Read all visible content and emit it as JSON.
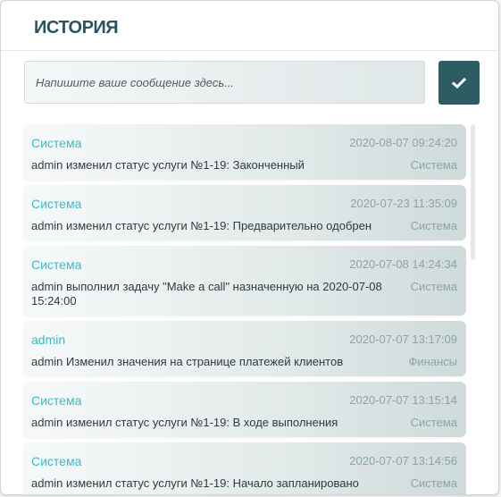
{
  "header": {
    "title": "ИСТОРИЯ"
  },
  "composer": {
    "placeholder": "Напишите ваше сообщение здесь...",
    "send_icon": "checkmark-icon",
    "accent_color": "#2e5c63"
  },
  "history": [
    {
      "author": "Система",
      "date": "2020-08-07 09:24:20",
      "text": "admin изменил статус услуги №1-19: Законченный",
      "category": "Система"
    },
    {
      "author": "Система",
      "date": "2020-07-23 11:35:09",
      "text": "admin изменил статус услуги №1-19: Предварительно одобрен",
      "category": "Система"
    },
    {
      "author": "Система",
      "date": "2020-07-08 14:24:34",
      "text": "admin выполнил задачу \"Make a call\" назначенную на 2020-07-08 15:24:00",
      "category": "Система"
    },
    {
      "author": "admin",
      "date": "2020-07-07 13:17:09",
      "text": "admin Изменил значения на странице платежей клиентов",
      "category": "Финансы"
    },
    {
      "author": "Система",
      "date": "2020-07-07 13:15:14",
      "text": "admin изменил статус услуги №1-19: В ходе выполнения",
      "category": "Система"
    },
    {
      "author": "Система",
      "date": "2020-07-07 13:14:56",
      "text": "admin изменил статус услуги №1-19: Начало запланировано",
      "category": "Система"
    }
  ],
  "colors": {
    "author": "#3fb8bf",
    "meta": "#8aa5a9",
    "title": "#2c5460"
  }
}
